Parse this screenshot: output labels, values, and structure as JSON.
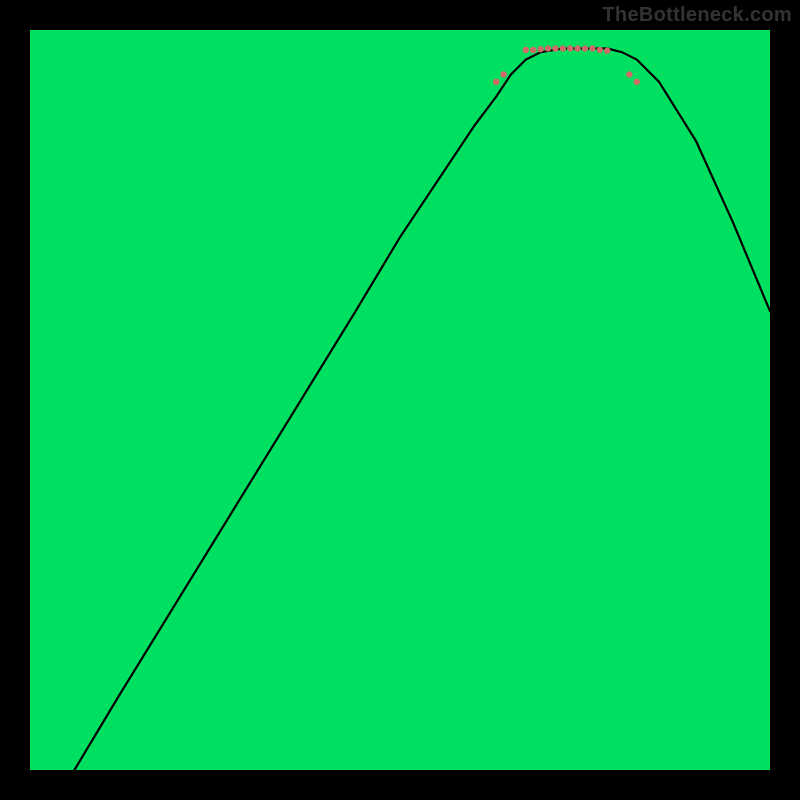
{
  "watermark": "TheBottleneck.com",
  "chart_data": {
    "type": "line",
    "title": "",
    "xlabel": "",
    "ylabel": "",
    "xlim": [
      0,
      100
    ],
    "ylim": [
      0,
      100
    ],
    "grid": false,
    "legend": false,
    "gradient": {
      "stops": [
        {
          "offset": 0,
          "color": "#ff1a4a"
        },
        {
          "offset": 25,
          "color": "#ff5533"
        },
        {
          "offset": 50,
          "color": "#ffd500"
        },
        {
          "offset": 75,
          "color": "#ffff33"
        },
        {
          "offset": 93,
          "color": "#ffffb0"
        },
        {
          "offset": 100,
          "color": "#00e060"
        }
      ]
    },
    "green_band": {
      "y_from": 97.5,
      "y_to": 100,
      "color": "#00e060"
    },
    "series": [
      {
        "name": "curve",
        "color": "#000000",
        "x": [
          6,
          12,
          20,
          28,
          36,
          44,
          50,
          56,
          60,
          63,
          65,
          67,
          69,
          72,
          75,
          78,
          80,
          82,
          85,
          90,
          95,
          100
        ],
        "y": [
          0,
          10,
          23,
          36,
          49,
          62,
          72,
          81,
          87,
          91,
          94,
          96,
          97,
          97.5,
          97.5,
          97.5,
          97,
          96,
          93,
          85,
          74,
          62
        ]
      }
    ],
    "dotted_region": {
      "color": "#d06a66",
      "points": [
        {
          "x": 63,
          "y": 93
        },
        {
          "x": 64,
          "y": 94
        },
        {
          "x": 67,
          "y": 97.3
        },
        {
          "x": 68,
          "y": 97.3
        },
        {
          "x": 69,
          "y": 97.4
        },
        {
          "x": 70,
          "y": 97.5
        },
        {
          "x": 71,
          "y": 97.5
        },
        {
          "x": 72,
          "y": 97.5
        },
        {
          "x": 73,
          "y": 97.5
        },
        {
          "x": 74,
          "y": 97.5
        },
        {
          "x": 75,
          "y": 97.5
        },
        {
          "x": 76,
          "y": 97.5
        },
        {
          "x": 77,
          "y": 97.3
        },
        {
          "x": 78,
          "y": 97.2
        },
        {
          "x": 81,
          "y": 94
        },
        {
          "x": 82,
          "y": 93
        }
      ]
    }
  }
}
